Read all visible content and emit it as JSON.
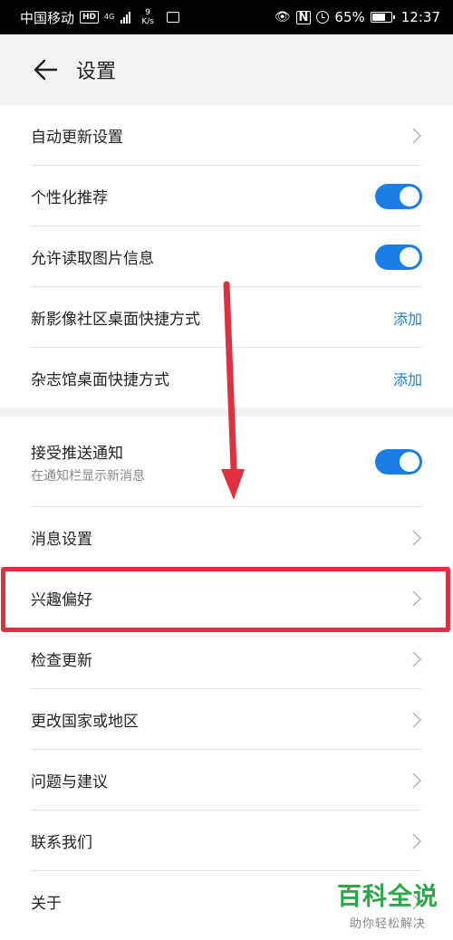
{
  "status_bar": {
    "carrier": "中国移动",
    "hd": "HD",
    "network": "4G",
    "speed_value": "9",
    "speed_unit": "K/s",
    "battery": "65%",
    "battery_level": 0.65,
    "time": "12:37"
  },
  "header": {
    "title": "设置",
    "back_icon": "arrow-left-icon"
  },
  "group1": [
    {
      "label": "自动更新设置",
      "control": "chevron"
    },
    {
      "label": "个性化推荐",
      "control": "toggle",
      "on": true
    },
    {
      "label": "允许读取图片信息",
      "control": "toggle",
      "on": true
    },
    {
      "label": "新影像社区桌面快捷方式",
      "control": "link",
      "link_label": "添加"
    },
    {
      "label": "杂志馆桌面快捷方式",
      "control": "link",
      "link_label": "添加"
    }
  ],
  "group2": [
    {
      "label": "接受推送通知",
      "sublabel": "在通知栏显示新消息",
      "control": "toggle",
      "on": true
    },
    {
      "label": "消息设置",
      "control": "chevron"
    },
    {
      "label": "兴趣偏好",
      "control": "chevron"
    },
    {
      "label": "检查更新",
      "control": "chevron"
    },
    {
      "label": "更改国家或地区",
      "control": "chevron"
    },
    {
      "label": "问题与建议",
      "control": "chevron"
    },
    {
      "label": "联系我们",
      "control": "chevron"
    },
    {
      "label": "关于",
      "control": "chevron"
    }
  ],
  "colors": {
    "accent": "#1a7ee6",
    "link": "#1c7fd8",
    "annotation": "#e0303f",
    "watermark": "#2aa84a"
  },
  "watermark": {
    "main": "百科全说",
    "sub": "助你轻松解决"
  }
}
